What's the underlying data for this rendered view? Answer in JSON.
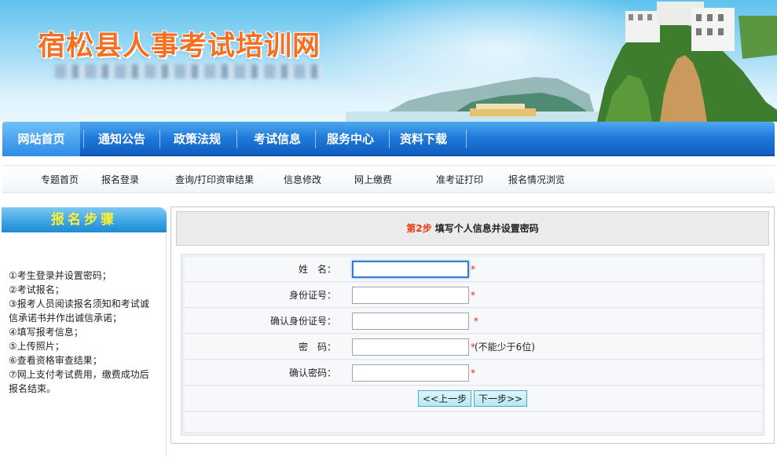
{
  "header": {
    "site_title": "宿松县人事考试培训网"
  },
  "main_nav": {
    "items": [
      {
        "label": "网站首页",
        "active": true
      },
      {
        "label": "通知公告",
        "active": false
      },
      {
        "label": "政策法规",
        "active": false
      },
      {
        "label": "考试信息",
        "active": false
      },
      {
        "label": "服务中心",
        "active": false
      },
      {
        "label": "资料下载",
        "active": false
      }
    ]
  },
  "sub_nav": {
    "items": [
      "专题首页",
      "报名登录",
      "查询/打印资审结果",
      "信息修改",
      "网上缴费",
      "准考证打印",
      "报名情况浏览"
    ]
  },
  "sidebar": {
    "title": "报名步骤",
    "steps": [
      "①考生登录并设置密码；",
      "②考试报名；",
      "③报考人员阅读报名须知和考试诚",
      "信承诺书并作出诚信承诺；",
      "④填写报考信息；",
      "⑤上传照片；",
      "⑥查看资格审查结果；",
      "⑦网上支付考试费用，缴费成功后",
      "报名结束。"
    ]
  },
  "form": {
    "step_number": "第2步",
    "step_title": "填写个人信息并设置密码",
    "fields": [
      {
        "label": "姓　名：",
        "value": "",
        "required_mark": "*",
        "hint": ""
      },
      {
        "label": "身份证号：",
        "value": "",
        "required_mark": "*",
        "hint": ""
      },
      {
        "label": "确认身份证号：",
        "value": "",
        "required_mark": "*",
        "hint": ""
      },
      {
        "label": "密　码：",
        "value": "",
        "required_mark": "*",
        "hint": "(不能少于6位)"
      },
      {
        "label": "确认密码：",
        "value": "",
        "required_mark": "*",
        "hint": ""
      }
    ],
    "prev_button": "<<上一步",
    "next_button": "下一步>>"
  },
  "colors": {
    "nav_blue": "#1f78d8",
    "title_orange": "#f46f1f",
    "step_red": "#e8380d",
    "sidebar_title_yellow": "#ffee33",
    "required_red": "#e8261f"
  }
}
